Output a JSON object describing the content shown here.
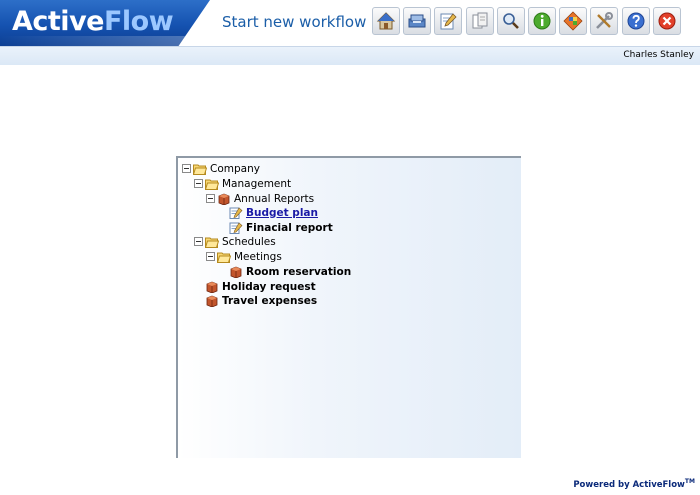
{
  "header": {
    "logo": {
      "part1": "Active",
      "part2": "Flow"
    },
    "title": "Start new workflow",
    "toolbar": [
      {
        "name": "home-button",
        "icon": "home-icon"
      },
      {
        "name": "inbox-button",
        "icon": "inbox-icon"
      },
      {
        "name": "edit-button",
        "icon": "edit-icon"
      },
      {
        "name": "documents-button",
        "icon": "documents-icon"
      },
      {
        "name": "search-button",
        "icon": "search-icon"
      },
      {
        "name": "info-button",
        "icon": "info-icon"
      },
      {
        "name": "workflow-button",
        "icon": "workflow-icon"
      },
      {
        "name": "tools-button",
        "icon": "tools-icon"
      },
      {
        "name": "help-button",
        "icon": "help-icon"
      },
      {
        "name": "close-button",
        "icon": "close-icon"
      }
    ]
  },
  "user": {
    "name": "Charles Stanley"
  },
  "tree": {
    "nodes": [
      {
        "label": "Company",
        "level": 0,
        "type": "folder",
        "expanded": true
      },
      {
        "label": "Management",
        "level": 1,
        "type": "folder",
        "expanded": true
      },
      {
        "label": "Annual Reports",
        "level": 2,
        "type": "box",
        "expanded": true
      },
      {
        "label": "Budget plan",
        "level": 3,
        "type": "form",
        "style": "link"
      },
      {
        "label": "Finacial report",
        "level": 3,
        "type": "form",
        "style": "bold"
      },
      {
        "label": "Schedules",
        "level": 1,
        "type": "folder",
        "expanded": true
      },
      {
        "label": "Meetings",
        "level": 2,
        "type": "folder",
        "expanded": true
      },
      {
        "label": "Room reservation",
        "level": 3,
        "type": "box",
        "style": "bold"
      },
      {
        "label": "Holiday request",
        "level": 1,
        "type": "box",
        "style": "bold"
      },
      {
        "label": "Travel expenses",
        "level": 1,
        "type": "box",
        "style": "bold"
      }
    ]
  },
  "footer": {
    "text": "Powered by ActiveFlow",
    "tm": "TM"
  },
  "colors": {
    "logo_blue": "#1552b0",
    "title_blue": "#1b5ea8",
    "link_blue": "#1a1aa6"
  }
}
